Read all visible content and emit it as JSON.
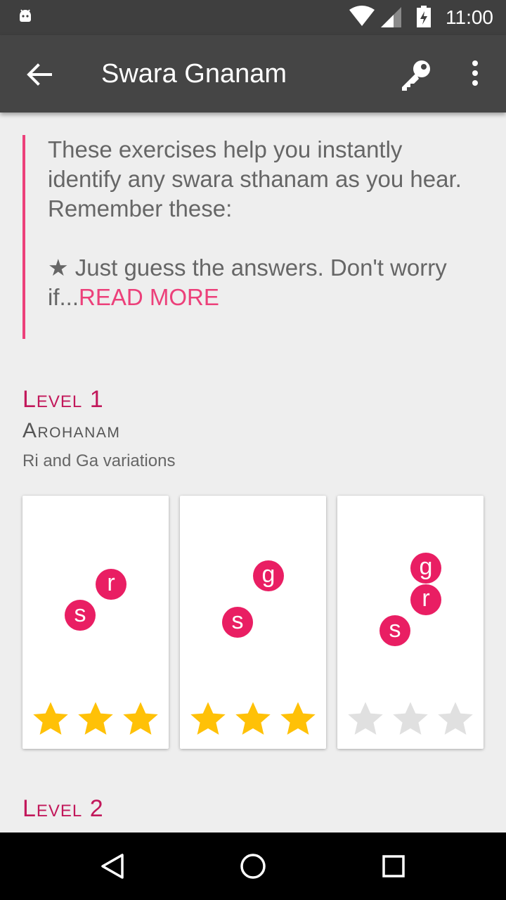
{
  "status_bar": {
    "time": "11:00"
  },
  "app_bar": {
    "title": "Swara Gnanam"
  },
  "intro": {
    "line1": "These exercises help you instantly",
    "line2": "identify any swara sthanam as you hear.",
    "line3": "Remember these:",
    "line4": "★ Just guess the answers. Don't worry",
    "line5_prefix": "if...",
    "read_more": "READ MORE"
  },
  "levels": [
    {
      "heading": "Level 1",
      "name": "Arohanam",
      "subtitle": "Ri and Ga variations",
      "exercises": [
        {
          "notes": [
            "s",
            "r"
          ],
          "stars_earned": 3,
          "stars_total": 3
        },
        {
          "notes": [
            "s",
            "g"
          ],
          "stars_earned": 3,
          "stars_total": 3
        },
        {
          "notes": [
            "s",
            "r",
            "g"
          ],
          "stars_earned": 0,
          "stars_total": 3
        }
      ]
    },
    {
      "heading": "Level 2"
    }
  ],
  "colors": {
    "accent": "#ec407a",
    "level_heading": "#c2185b",
    "note_bubble": "#e91e63",
    "star_filled": "#ffc107",
    "star_empty": "#e0e0e0",
    "app_bar": "#454545",
    "status_bar": "#3f3f3f"
  }
}
